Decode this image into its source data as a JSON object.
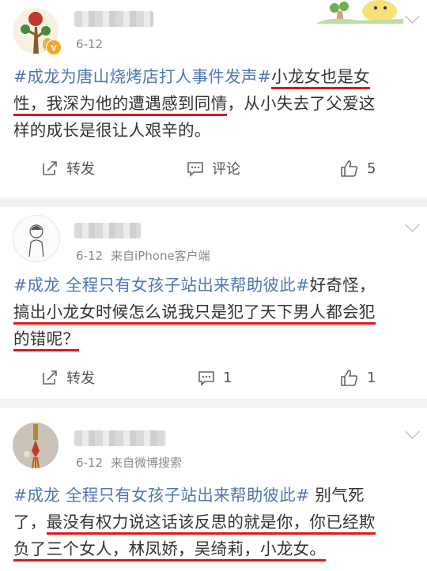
{
  "posts": [
    {
      "date": "6-12",
      "source": "",
      "lines": [
        [
          {
            "t": "#成龙为唐山烧烤店打人事件发声#",
            "s": "tag"
          },
          {
            "t": "小龙女也是女",
            "s": "ul"
          }
        ],
        [
          {
            "t": "性，我深为他的遭遇感到同情",
            "s": "ul"
          },
          {
            "t": "，从小失去了父爱这",
            "s": ""
          }
        ],
        [
          {
            "t": "样的成长是很让人艰辛的。",
            "s": ""
          }
        ]
      ],
      "repost_label": "转发",
      "comment_label": "评论",
      "like_count": "5"
    },
    {
      "date": "6-12",
      "source": "来自iPhone客户端",
      "lines": [
        [
          {
            "t": "#成龙 全程只有女孩子站出来帮助彼此#",
            "s": "tag"
          },
          {
            "t": "好奇怪，",
            "s": ""
          }
        ],
        [
          {
            "t": "搞出小龙女时候怎么说我只是犯了天下男人都会犯",
            "s": "ul"
          }
        ],
        [
          {
            "t": "的错呢？",
            "s": "ul"
          }
        ]
      ],
      "repost_label": "转发",
      "comment_label": "1",
      "like_count": "1"
    },
    {
      "date": "6-12",
      "source": "来自微博搜索",
      "lines": [
        [
          {
            "t": "#成龙 全程只有女孩子站出来帮助彼此#",
            "s": "tag"
          },
          {
            "t": " 别气死",
            "s": ""
          }
        ],
        [
          {
            "t": "了，",
            "s": ""
          },
          {
            "t": "最没有权力说这话该反思的就是你，你已经欺",
            "s": "ul"
          }
        ],
        [
          {
            "t": "负了三个女人，林凤娇，吴绮莉，小龙女。",
            "s": "ul"
          }
        ]
      ]
    }
  ],
  "colors": {
    "hashtag": "#4f78b0",
    "underline": "#e0161d",
    "separator": "#f2f2f2",
    "verified": "#f5a623"
  }
}
